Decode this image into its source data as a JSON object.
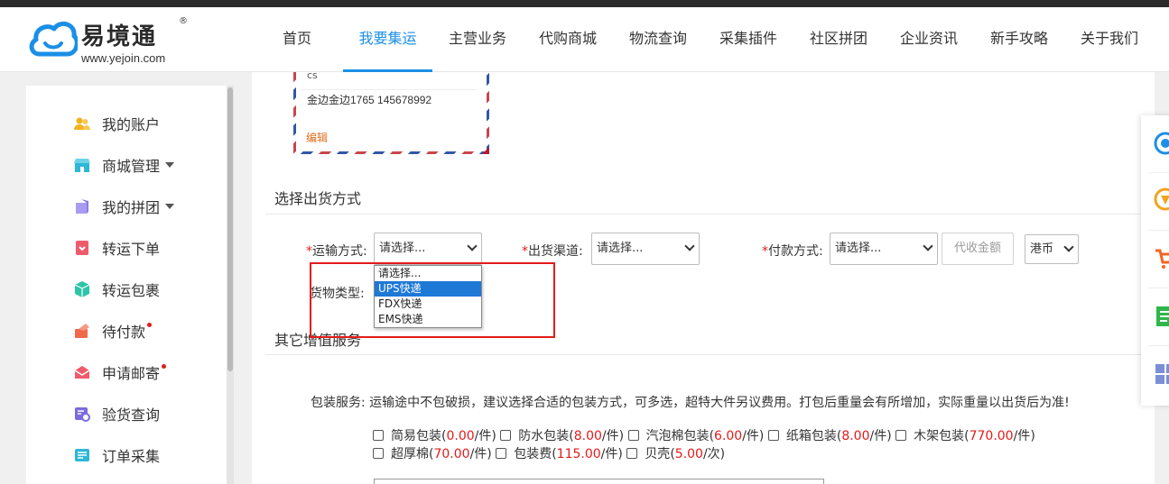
{
  "logo": {
    "name": "易境通",
    "reg": "®",
    "url": "www.yejoin.com"
  },
  "nav": [
    {
      "label": "首页",
      "active": false
    },
    {
      "label": "我要集运",
      "active": true
    },
    {
      "label": "主营业务",
      "active": false
    },
    {
      "label": "代购商城",
      "active": false
    },
    {
      "label": "物流查询",
      "active": false
    },
    {
      "label": "采集插件",
      "active": false
    },
    {
      "label": "社区拼团",
      "active": false
    },
    {
      "label": "企业资讯",
      "active": false
    },
    {
      "label": "新手攻略",
      "active": false
    },
    {
      "label": "关于我们",
      "active": false
    }
  ],
  "sidebar": {
    "items": [
      {
        "label": "我的账户",
        "icon": "user-group-icon",
        "color": "#f2b21f"
      },
      {
        "label": "商城管理",
        "icon": "shop-icon",
        "color": "#2fb7d6",
        "dropdown": true
      },
      {
        "label": "我的拼团",
        "icon": "group-buy-icon",
        "color": "#8c7be8",
        "dropdown": true
      },
      {
        "label": "转运下单",
        "icon": "order-icon",
        "color": "#ef5b6b"
      },
      {
        "label": "转运包裹",
        "icon": "package-icon",
        "color": "#2ec4a8"
      },
      {
        "label": "待付款",
        "icon": "payment-icon",
        "color": "#ef6a4c",
        "badge": true
      },
      {
        "label": "申请邮寄",
        "icon": "mail-icon",
        "color": "#ef5b6b",
        "badge": true
      },
      {
        "label": "验货查询",
        "icon": "inspect-icon",
        "color": "#7b6be0"
      },
      {
        "label": "订单采集",
        "icon": "collect-icon",
        "color": "#2fb7d6"
      }
    ]
  },
  "address": {
    "top_text": "cs",
    "contact": "金边金边1765 145678992",
    "edit_label": "编辑"
  },
  "shipping": {
    "title": "选择出货方式",
    "transport_label": "运输方式:",
    "transport_value": "请选择...",
    "channel_label": "出货渠道:",
    "channel_value": "请选择...",
    "payment_label": "付款方式:",
    "payment_value": "请选择...",
    "cod_placeholder": "代收金额",
    "currency_value": "港币",
    "goods_type_label": "货物类型:",
    "dropdown_options": [
      "请选择...",
      "UPS快递",
      "FDX快递",
      "EMS快递"
    ],
    "dropdown_selected_index": 1
  },
  "value_added": {
    "title": "其它增值服务",
    "packing_label": "包装服务:",
    "packing_note": "运输途中不包破损，建议选择合适的包装方式，可多选，超特大件另议费用。打包后重量会有所增加，实际重量以出货后为准!",
    "options": [
      {
        "name": "简易包装",
        "price": "0.00",
        "unit": "/件"
      },
      {
        "name": "防水包装",
        "price": "8.00",
        "unit": "/件"
      },
      {
        "name": "汽泡棉包装",
        "price": "6.00",
        "unit": "/件"
      },
      {
        "name": "纸箱包装",
        "price": "8.00",
        "unit": "/件"
      },
      {
        "name": "木架包装",
        "price": "770.00",
        "unit": "/件"
      },
      {
        "name": "超厚棉",
        "price": "70.00",
        "unit": "/件"
      },
      {
        "name": "包装费",
        "price": "115.00",
        "unit": "/件"
      },
      {
        "name": "贝壳",
        "price": "5.00",
        "unit": "/次"
      }
    ]
  },
  "colors": {
    "accent": "#1b8fe6",
    "required": "#e31b1b",
    "price": "#e31b1b",
    "edit": "#e06d1c"
  }
}
